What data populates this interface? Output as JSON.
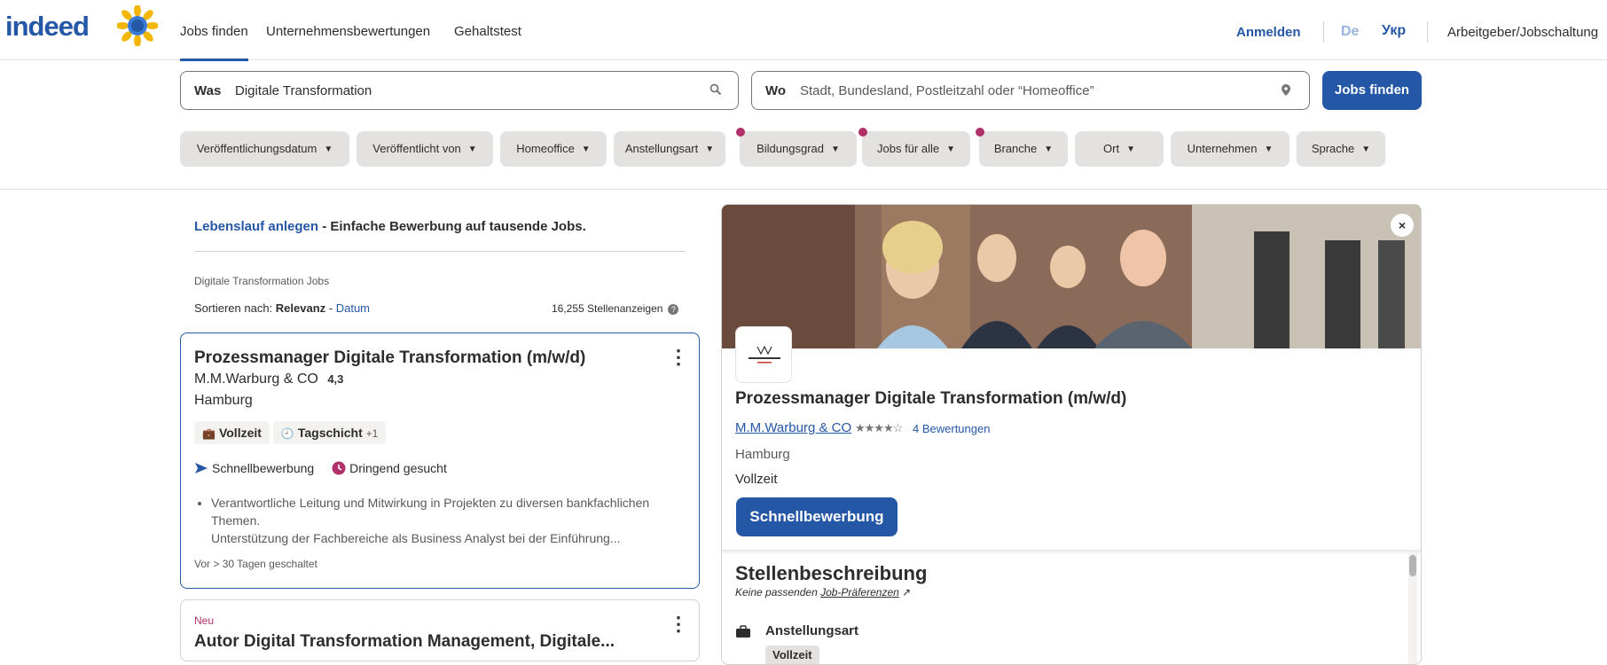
{
  "header": {
    "logo": "indeed",
    "nav": [
      "Jobs finden",
      "Unternehmensbewertungen",
      "Gehaltstest"
    ],
    "login": "Anmelden",
    "lang_de": "De",
    "lang_uk": "Укр",
    "employer": "Arbeitgeber/Jobschaltung"
  },
  "search": {
    "what_label": "Was",
    "what_value": "Digitale Transformation",
    "where_label": "Wo",
    "where_placeholder": "Stadt, Bundesland, Postleitzahl oder “Homeoffice”",
    "button": "Jobs finden"
  },
  "filters": [
    {
      "label": "Veröffentlichungsdatum",
      "dot": false
    },
    {
      "label": "Veröffentlicht von",
      "dot": false
    },
    {
      "label": "Homeoffice",
      "dot": false
    },
    {
      "label": "Anstellungsart",
      "dot": false
    },
    {
      "label": "Bildungsgrad",
      "dot": true
    },
    {
      "label": "Jobs für alle",
      "dot": true
    },
    {
      "label": "Branche",
      "dot": true
    },
    {
      "label": "Ort",
      "dot": false
    },
    {
      "label": "Unternehmen",
      "dot": false
    },
    {
      "label": "Sprache",
      "dot": false
    }
  ],
  "results": {
    "resume_link": "Lebenslauf anlegen",
    "resume_text": " - Einfache Bewerbung auf tausende Jobs.",
    "breadcrumb": "Digitale Transformation Jobs",
    "sort_prefix": "Sortieren nach: ",
    "sort_active": "Relevanz",
    "sort_sep": " - ",
    "sort_alt": "Datum",
    "count": "16,255 Stellenanzeigen",
    "jobs": [
      {
        "title": "Prozessmanager Digitale Transformation (m/w/d)",
        "company": "M.M.Warburg & CO",
        "rating": "4,3",
        "location": "Hamburg",
        "tag1": "Vollzeit",
        "tag2": "Tagschicht",
        "tag2_more": "+1",
        "quick": "Schnellbewerbung",
        "urgent": "Dringend gesucht",
        "bullets": [
          "Verantwortliche Leitung und Mitwirkung in Projekten zu diversen bankfachlichen Themen.",
          "Unterstützung der Fachbereiche als Business Analyst bei der Einführung..."
        ],
        "posted": "Vor > 30 Tagen geschaltet"
      },
      {
        "new": "Neu",
        "title": "Autor Digital Transformation Management, Digitale..."
      }
    ]
  },
  "detail": {
    "close": "×",
    "title": "Prozessmanager Digitale Transformation (m/w/d)",
    "company": "M.M.Warburg & CO",
    "rating_value": 4.3,
    "reviews": "4 Bewertungen",
    "location": "Hamburg",
    "type": "Vollzeit",
    "apply": "Schnellbewerbung",
    "desc_heading": "Stellenbeschreibung",
    "pref_prefix": "Keine passenden ",
    "pref_link": "Job-Präferenzen",
    "section_type": "Anstellungsart",
    "section_type_value": "Vollzeit"
  },
  "colors": {
    "brand": "#2557a7",
    "dot": "#b0306a"
  }
}
